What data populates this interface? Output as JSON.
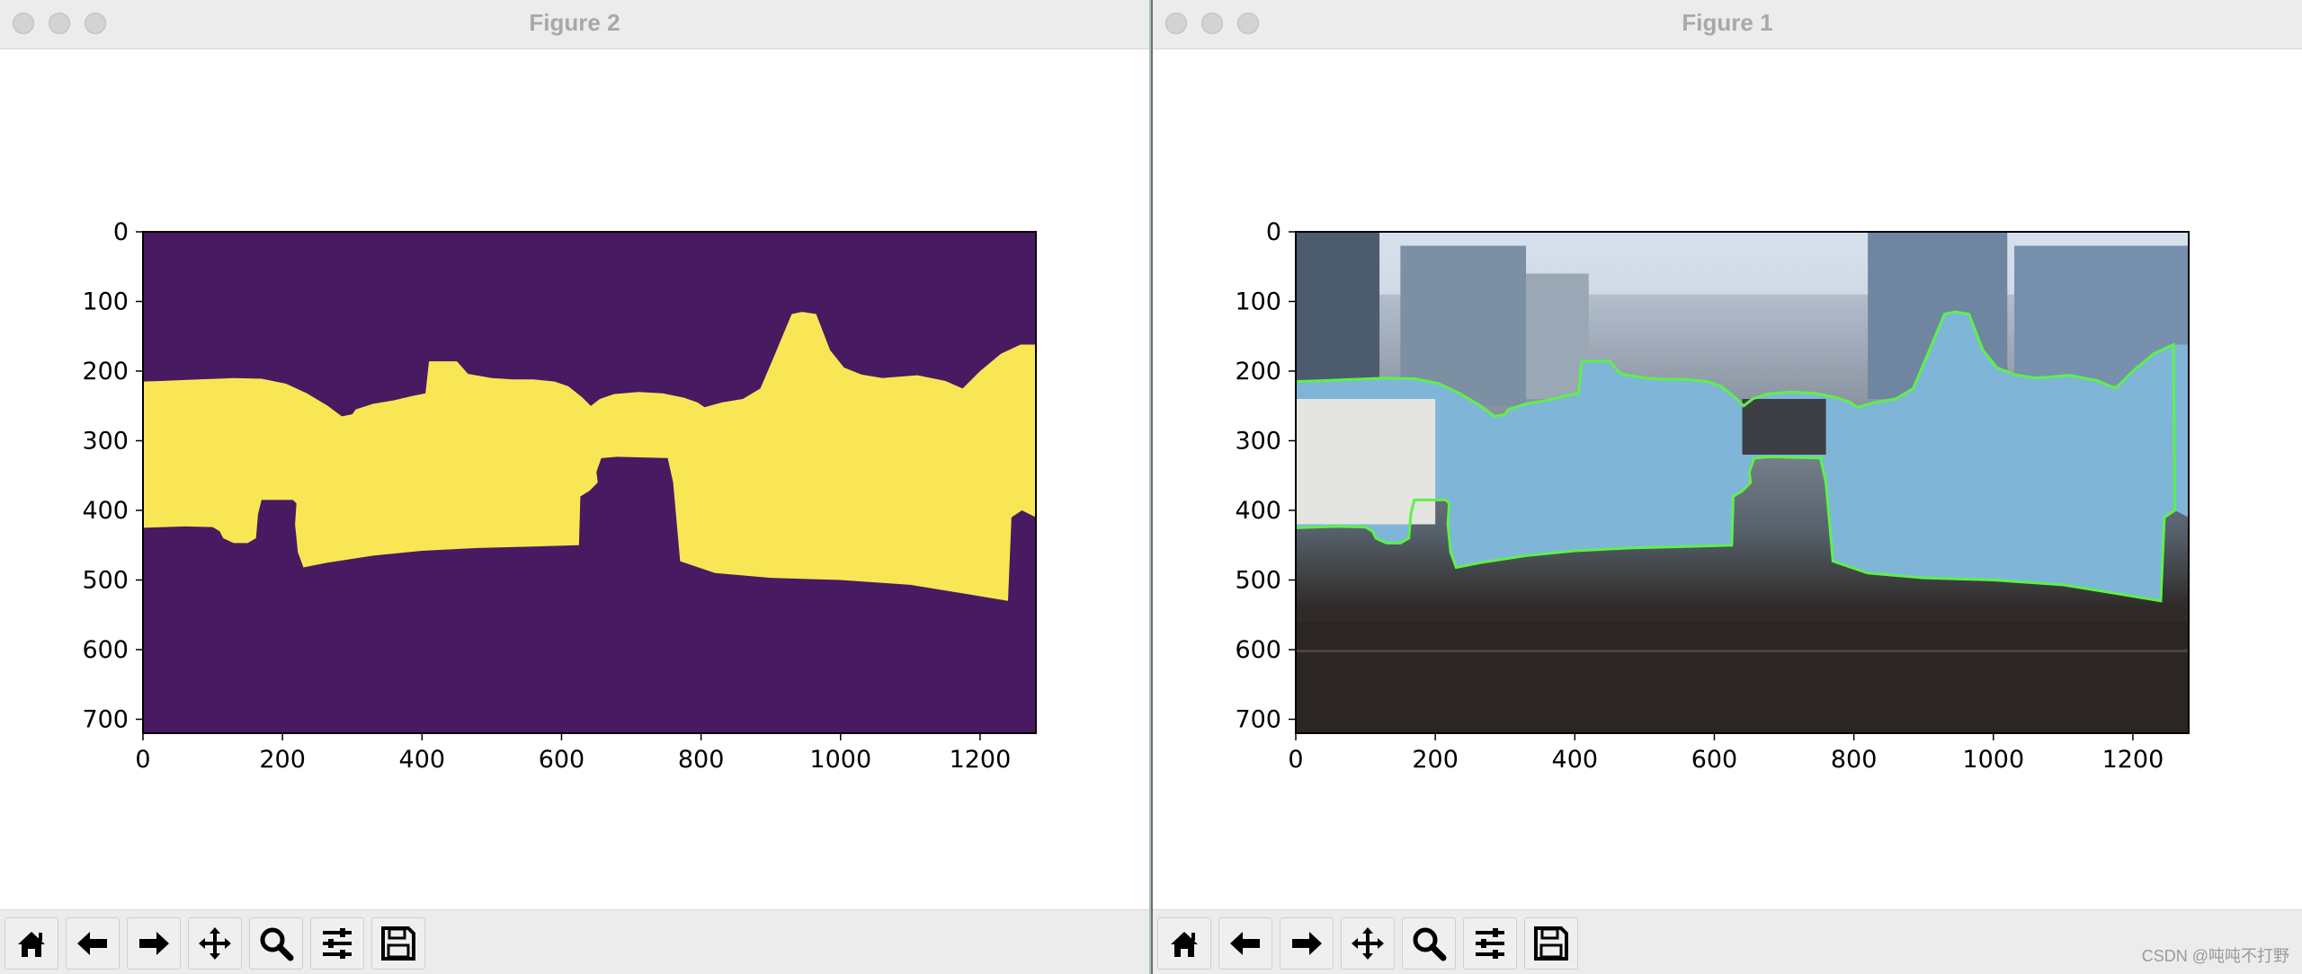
{
  "figures": [
    {
      "id": "win2",
      "title": "Figure 2",
      "plot": "mask",
      "colors": {
        "background": "#481a61",
        "foreground": "#f8e655"
      }
    },
    {
      "id": "win1",
      "title": "Figure 1",
      "plot": "photo",
      "colors": {
        "contour": "#5ef14a"
      }
    }
  ],
  "axes": {
    "x_ticks": [
      "0",
      "200",
      "400",
      "600",
      "800",
      "1000",
      "1200"
    ],
    "y_ticks": [
      "0",
      "100",
      "200",
      "300",
      "400",
      "500",
      "600",
      "700"
    ]
  },
  "chart_data": [
    {
      "type": "heatmap",
      "title": "Figure 2",
      "xlim": [
        0,
        1280
      ],
      "ylim": [
        720,
        0
      ],
      "x_ticks": [
        0,
        200,
        400,
        600,
        800,
        1000,
        1200
      ],
      "y_ticks": [
        0,
        100,
        200,
        300,
        400,
        500,
        600,
        700
      ],
      "colormap": "viridis",
      "values": [
        0,
        1
      ],
      "grid": false
    },
    {
      "type": "heatmap",
      "title": "Figure 1",
      "xlim": [
        0,
        1280
      ],
      "ylim": [
        720,
        0
      ],
      "x_ticks": [
        0,
        200,
        400,
        600,
        800,
        1000,
        1200
      ],
      "y_ticks": [
        0,
        100,
        200,
        300,
        400,
        500,
        600,
        700
      ],
      "grid": false
    }
  ],
  "toolbar": [
    {
      "name": "home-button",
      "icon": "home-icon"
    },
    {
      "name": "back-button",
      "icon": "arrow-left-icon"
    },
    {
      "name": "forward-button",
      "icon": "arrow-right-icon"
    },
    {
      "name": "pan-button",
      "icon": "move-icon"
    },
    {
      "name": "zoom-button",
      "icon": "magnifier-icon"
    },
    {
      "name": "configure-subplots-button",
      "icon": "sliders-icon"
    },
    {
      "name": "save-button",
      "icon": "floppy-disk-icon"
    }
  ],
  "watermark": "CSDN @吨吨不打野"
}
